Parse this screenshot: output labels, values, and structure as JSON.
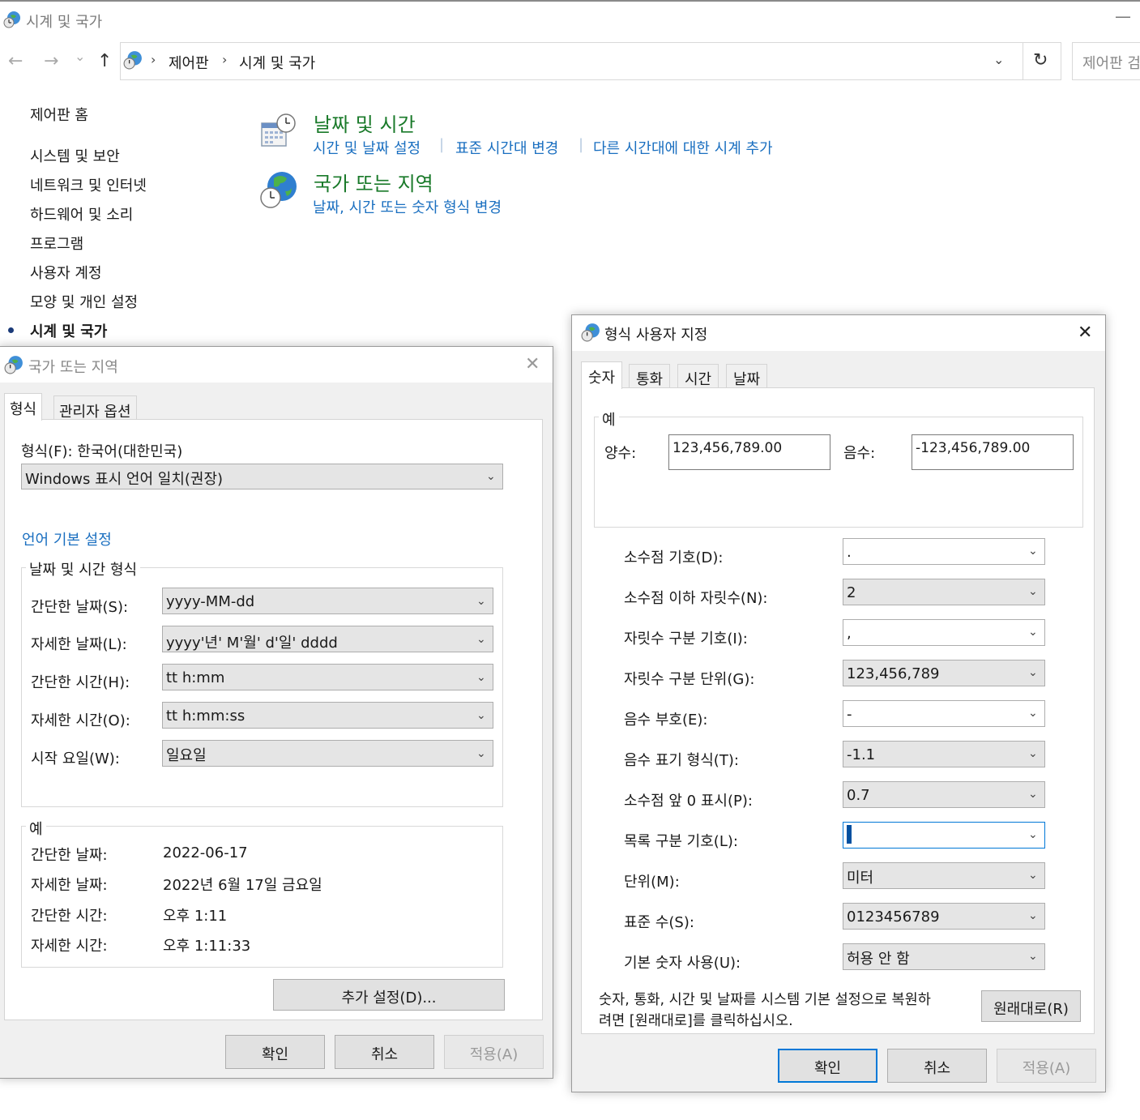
{
  "window": {
    "title": "시계 및 국가",
    "minimize_glyph": "—"
  },
  "nav": {
    "back": "←",
    "forward": "→",
    "recent": "⌄",
    "up": "↑",
    "separator": "›",
    "crumbs": [
      "제어판",
      "시계 및 국가"
    ],
    "dropdown": "⌄",
    "refresh": "↻",
    "search_placeholder": "제어판 검"
  },
  "sidebar": {
    "items": [
      {
        "label": "제어판 홈"
      },
      {
        "label": "시스템 및 보안"
      },
      {
        "label": "네트워크 및 인터넷"
      },
      {
        "label": "하드웨어 및 소리"
      },
      {
        "label": "프로그램"
      },
      {
        "label": "사용자 계정"
      },
      {
        "label": "모양 및 개인 설정"
      },
      {
        "label": "시계 및 국가"
      }
    ],
    "active_index": 7
  },
  "categories": [
    {
      "title": "날짜 및 시간",
      "links": [
        "시간 및 날짜 설정",
        "표준 시간대 변경",
        "다른 시간대에 대한 시계 추가"
      ]
    },
    {
      "title": "국가 또는 지역",
      "links": [
        "날짜, 시간 또는 숫자 형식 변경"
      ]
    }
  ],
  "region_dialog": {
    "title": "국가 또는 지역",
    "close": "✕",
    "tabs": [
      "형식",
      "관리자 옵션"
    ],
    "format_label": "형식(F): 한국어(대한민국)",
    "format_value": "Windows 표시 언어 일치(권장)",
    "language_link": "언어 기본 설정",
    "datetime_group": "날짜 및 시간 형식",
    "rows": [
      {
        "label": "간단한 날짜(S):",
        "value": "yyyy-MM-dd"
      },
      {
        "label": "자세한 날짜(L):",
        "value": "yyyy'년' M'월' d'일' dddd"
      },
      {
        "label": "간단한 시간(H):",
        "value": "tt h:mm"
      },
      {
        "label": "자세한 시간(O):",
        "value": "tt h:mm:ss"
      },
      {
        "label": "시작 요일(W):",
        "value": "일요일"
      }
    ],
    "example_group": "예",
    "examples": [
      {
        "label": "간단한 날짜:",
        "value": "2022-06-17"
      },
      {
        "label": "자세한 날짜:",
        "value": "2022년 6월 17일 금요일"
      },
      {
        "label": "간단한 시간:",
        "value": "오후 1:11"
      },
      {
        "label": "자세한 시간:",
        "value": "오후 1:11:33"
      }
    ],
    "more_settings": "추가 설정(D)...",
    "ok": "확인",
    "cancel": "취소",
    "apply": "적용(A)"
  },
  "custom_dialog": {
    "title": "형식 사용자 지정",
    "close": "✕",
    "tabs": [
      "숫자",
      "통화",
      "시간",
      "날짜"
    ],
    "example_group": "예",
    "positive_label": "양수:",
    "positive_value": "123,456,789.00",
    "negative_label": "음수:",
    "negative_value": "-123,456,789.00",
    "rows": [
      {
        "label": "소수점 기호(D):",
        "value": "."
      },
      {
        "label": "소수점 이하 자릿수(N):",
        "value": "2"
      },
      {
        "label": "자릿수 구분 기호(I):",
        "value": ","
      },
      {
        "label": "자릿수 구분 단위(G):",
        "value": "123,456,789"
      },
      {
        "label": "음수 부호(E):",
        "value": "-"
      },
      {
        "label": "음수 표기 형식(T):",
        "value": "-1.1"
      },
      {
        "label": "소수점 앞 0 표시(P):",
        "value": "0.7"
      },
      {
        "label": "목록 구분 기호(L):",
        "value": ""
      },
      {
        "label": "단위(M):",
        "value": "미터"
      },
      {
        "label": "표준 수(S):",
        "value": "0123456789"
      },
      {
        "label": "기본 숫자 사용(U):",
        "value": "허용 안 함"
      }
    ],
    "reset_text_line1": "숫자, 통화, 시간 및 날짜를 시스템 기본 설정으로 복원하",
    "reset_text_line2": "려면 [원래대로]를 클릭하십시오.",
    "reset_button": "원래대로(R)",
    "ok": "확인",
    "cancel": "취소",
    "apply": "적용(A)"
  }
}
